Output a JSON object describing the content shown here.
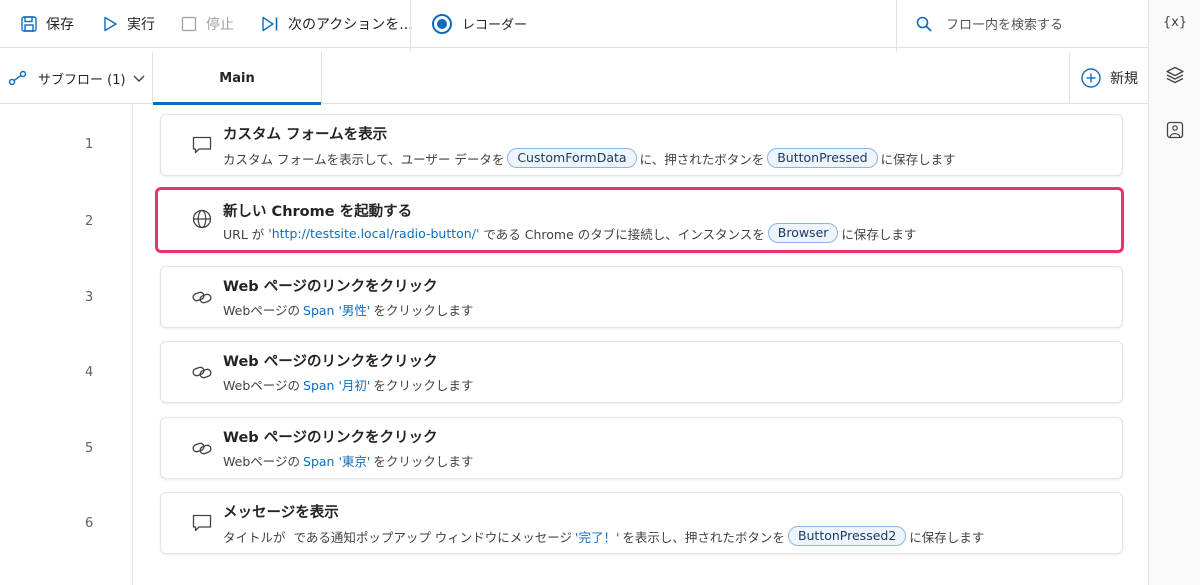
{
  "toolbar": {
    "save_label": "保存",
    "run_label": "実行",
    "stop_label": "停止",
    "next_label": "次のアクションを...",
    "recorder_label": "レコーダー",
    "search_placeholder": "フロー内を検索する"
  },
  "rail": {
    "variables_label": "{x}"
  },
  "tabs": {
    "subflow_label": "サブフロー (1)",
    "main_label": "Main",
    "new_label": "新規"
  },
  "steps": [
    {
      "number": "1",
      "icon": "message-icon",
      "title": "カスタム フォームを表示",
      "desc_a": "カスタム フォームを表示して、ユーザー データを",
      "var_a": "CustomFormData",
      "desc_b": "に、押されたボタンを",
      "var_b": "ButtonPressed",
      "desc_c": "に保存します"
    },
    {
      "number": "2",
      "icon": "globe-icon",
      "title": "新しい Chrome を起動する",
      "desc_a": "URL が",
      "url": "'http://testsite.local/radio-button/'",
      "desc_b": "である Chrome のタブに接続し、インスタンスを",
      "var_a": "Browser",
      "desc_c": "に保存します",
      "selected": true
    },
    {
      "number": "3",
      "icon": "link-icon",
      "title": "Web ページのリンクをクリック",
      "desc_a": "Webページの",
      "span": "Span '男性'",
      "desc_b": "をクリックします"
    },
    {
      "number": "4",
      "icon": "link-icon",
      "title": "Web ページのリンクをクリック",
      "desc_a": "Webページの",
      "span": "Span '月初'",
      "desc_b": "をクリックします"
    },
    {
      "number": "5",
      "icon": "link-icon",
      "title": "Web ページのリンクをクリック",
      "desc_a": "Webページの",
      "span": "Span '東京'",
      "desc_b": "をクリックします"
    },
    {
      "number": "6",
      "icon": "message-icon",
      "title": "メッセージを表示",
      "desc_a": "タイトルが  である通知ポップアップ ウィンドウにメッセージ",
      "msg": "'完了！'",
      "desc_b": "を表示し、押されたボタンを",
      "var_a": "ButtonPressed2",
      "desc_c": "に保存します"
    }
  ],
  "colors": {
    "accent": "#0f6cbd",
    "selection_border": "#e8336d"
  }
}
